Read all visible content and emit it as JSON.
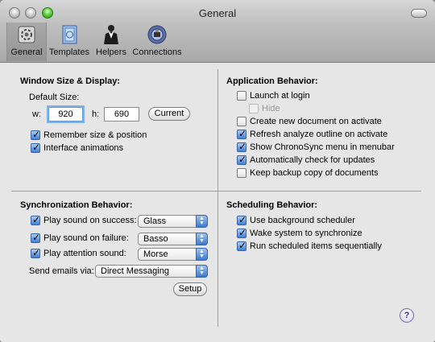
{
  "window": {
    "title": "General"
  },
  "toolbar": {
    "items": [
      {
        "label": "General",
        "selected": true
      },
      {
        "label": "Templates"
      },
      {
        "label": "Helpers"
      },
      {
        "label": "Connections"
      }
    ]
  },
  "window_size": {
    "title": "Window Size & Display:",
    "default_size_label": "Default Size:",
    "w_label": "w:",
    "w_value": "920",
    "h_label": "h:",
    "h_value": "690",
    "current_button": "Current",
    "remember_label": "Remember size & position",
    "remember_checked": true,
    "animations_label": "Interface animations",
    "animations_checked": true
  },
  "app_behavior": {
    "title": "Application Behavior:",
    "items": [
      {
        "label": "Launch at login",
        "checked": false
      },
      {
        "label": "Hide",
        "checked": false,
        "disabled": true
      },
      {
        "label": "Create new document on activate",
        "checked": false
      },
      {
        "label": "Refresh analyze outline on activate",
        "checked": true
      },
      {
        "label": "Show ChronoSync menu in menubar",
        "checked": true
      },
      {
        "label": "Automatically check for updates",
        "checked": true
      },
      {
        "label": "Keep backup copy of documents",
        "checked": false
      }
    ]
  },
  "sync_behavior": {
    "title": "Synchronization Behavior:",
    "success_label": "Play sound on success:",
    "success_sound": "Glass",
    "failure_label": "Play sound on failure:",
    "failure_sound": "Basso",
    "attention_label": "Play attention sound:",
    "attention_sound": "Morse",
    "emails_label": "Send emails via:",
    "emails_value": "Direct Messaging",
    "setup_button": "Setup"
  },
  "scheduling": {
    "title": "Scheduling Behavior:",
    "items": [
      {
        "label": "Use background scheduler",
        "checked": true
      },
      {
        "label": "Wake system to synchronize",
        "checked": true
      },
      {
        "label": "Run scheduled items sequentially",
        "checked": true
      }
    ]
  },
  "help": {
    "label": "?"
  },
  "colors": {
    "accent": "#3f7fd8",
    "window_bg": "#e6e6e6",
    "max_button": "#5fcf3a"
  }
}
